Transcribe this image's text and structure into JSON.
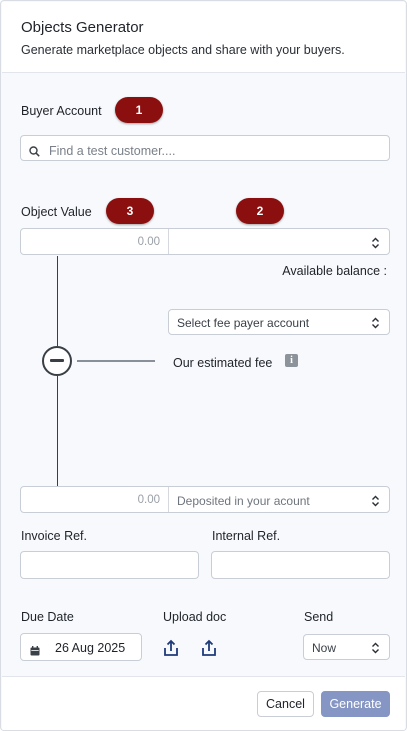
{
  "header": {
    "title": "Objects Generator",
    "subtitle": "Generate marketplace objects and share with your buyers."
  },
  "buyer_account": {
    "label": "Buyer Account",
    "badge": "1",
    "search_placeholder": "Find a test customer...."
  },
  "object_value": {
    "label": "Object Value",
    "badge_value": "3",
    "badge_select": "2",
    "amount": "0.00",
    "select_value": ""
  },
  "balance": {
    "label": "Available balance :"
  },
  "fee": {
    "payer_select": "Select fee payer account",
    "estimated_label": "Our estimated fee",
    "info_icon": "i"
  },
  "deposit": {
    "amount": "0.00",
    "select_value": "Deposited in your acount"
  },
  "invoice_ref": {
    "label": "Invoice Ref.",
    "value": ""
  },
  "internal_ref": {
    "label": "Internal Ref.",
    "value": ""
  },
  "due_date": {
    "label": "Due Date",
    "value": "26 Aug 2025"
  },
  "upload": {
    "label": "Upload doc"
  },
  "send": {
    "label": "Send",
    "value": "Now"
  },
  "footer": {
    "cancel": "Cancel",
    "generate": "Generate"
  },
  "colors": {
    "badge": "#8b0f0f",
    "primary_button": "#8595c4"
  },
  "icons": [
    "search-icon",
    "chevron-updown-icon",
    "minus-circle-icon",
    "info-icon",
    "calendar-icon",
    "upload-icon"
  ]
}
